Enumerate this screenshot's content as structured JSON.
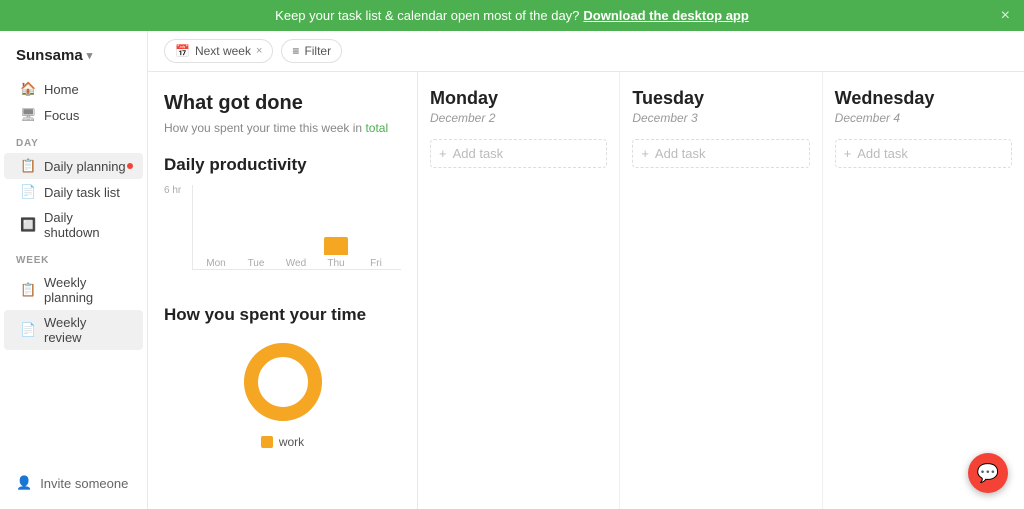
{
  "banner": {
    "message": "Keep your task list & calendar open most of the day?",
    "cta": "Download the desktop app",
    "close_label": "×"
  },
  "sidebar": {
    "logo": "Sunsama",
    "nav_items": [
      {
        "id": "home",
        "label": "Home",
        "icon": "🏠"
      },
      {
        "id": "focus",
        "label": "Focus",
        "icon": "🖥"
      }
    ],
    "day_section_label": "DAY",
    "day_items": [
      {
        "id": "daily-planning",
        "label": "Daily planning",
        "icon": "📋",
        "active": true,
        "dot": true
      },
      {
        "id": "daily-task-list",
        "label": "Daily task list",
        "icon": "📄"
      },
      {
        "id": "daily-shutdown",
        "label": "Daily shutdown",
        "icon": "🔲"
      }
    ],
    "week_section_label": "WEEK",
    "week_items": [
      {
        "id": "weekly-planning",
        "label": "Weekly planning",
        "icon": "📋"
      },
      {
        "id": "weekly-review",
        "label": "Weekly review",
        "icon": "📄",
        "active": true
      }
    ],
    "footer": {
      "label": "Invite someone",
      "icon": "👤"
    }
  },
  "toolbar": {
    "chips": [
      {
        "id": "next-week",
        "label": "Next week",
        "icon": "📅",
        "closable": true
      },
      {
        "id": "filter",
        "label": "Filter",
        "icon": "≡",
        "closable": false
      }
    ]
  },
  "summary": {
    "title": "What got done",
    "subtitle": "How you spent your time this week in",
    "subtitle_link": "total",
    "productivity": {
      "title": "Daily productivity",
      "y_label": "6 hr",
      "bars": [
        {
          "day": "Mon",
          "height": 0
        },
        {
          "day": "Tue",
          "height": 0
        },
        {
          "day": "Wed",
          "height": 0
        },
        {
          "day": "Thu",
          "height": 8,
          "highlight": true
        },
        {
          "day": "Fri",
          "height": 0
        }
      ]
    },
    "time_spent": {
      "title": "How you spent your time",
      "donut": {
        "color": "#f5a623",
        "percentage": 100
      },
      "legend": [
        {
          "label": "work",
          "color": "#f5a623"
        }
      ]
    }
  },
  "calendar": {
    "days": [
      {
        "id": "monday",
        "name": "Monday",
        "date": "December 2",
        "add_task_label": "Add task"
      },
      {
        "id": "tuesday",
        "name": "Tuesday",
        "date": "December 3",
        "add_task_label": "Add task"
      },
      {
        "id": "wednesday",
        "name": "Wednesday",
        "date": "December 4",
        "add_task_label": "Add task"
      }
    ]
  },
  "chat_bubble": {
    "icon": "💬"
  }
}
